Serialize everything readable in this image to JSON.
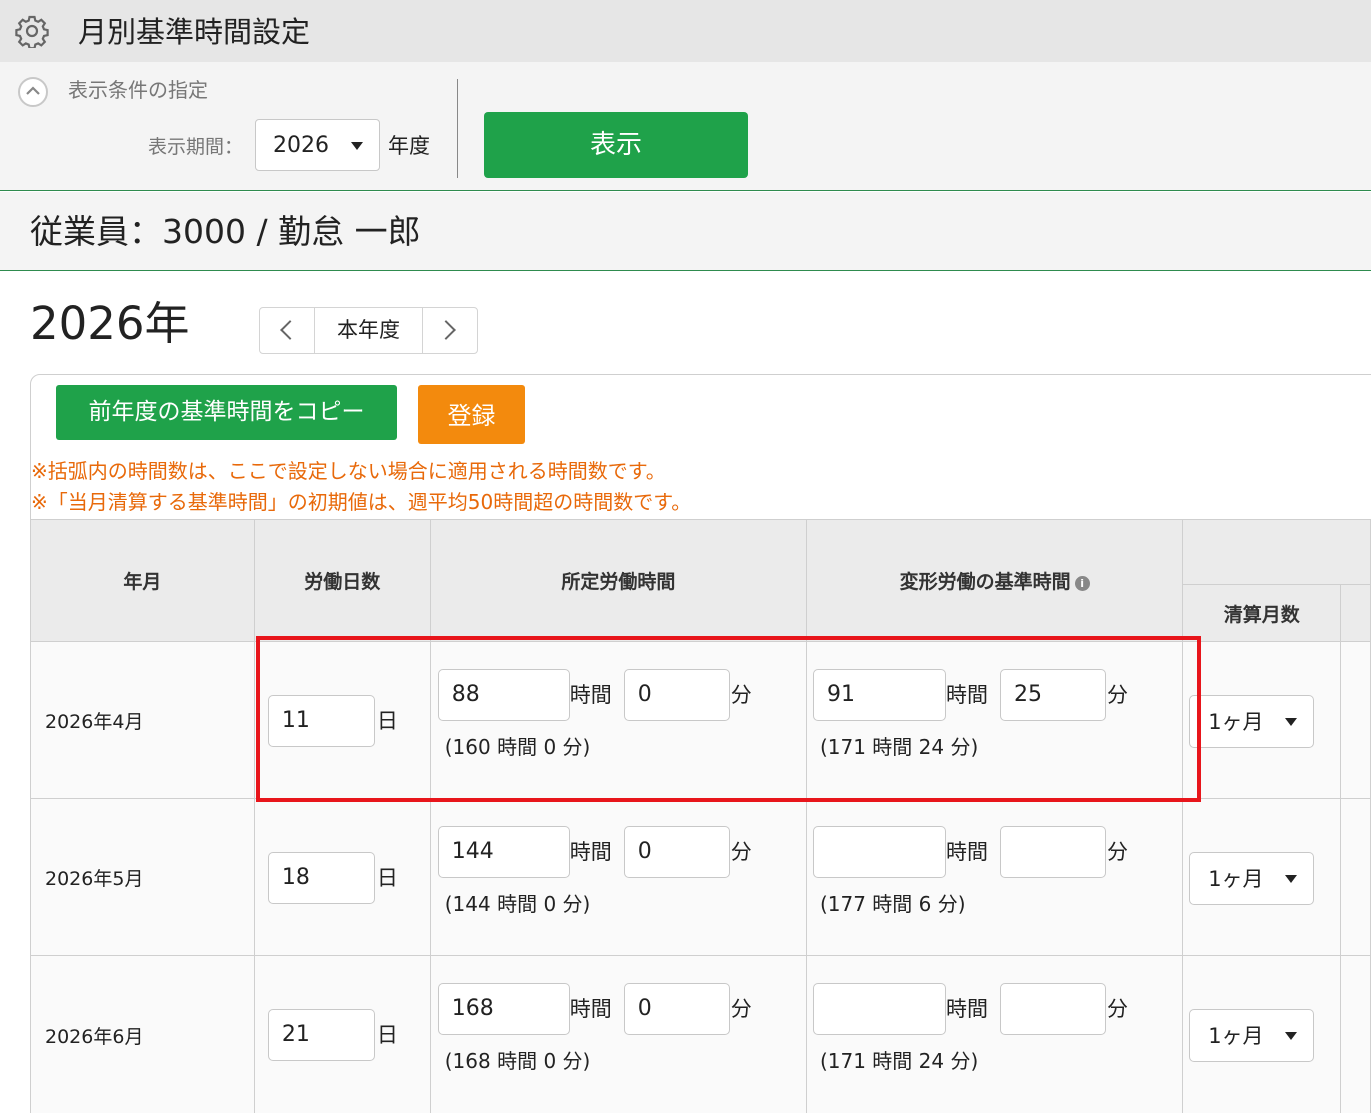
{
  "header": {
    "title": "月別基準時間設定",
    "icon": "gear-icon"
  },
  "conditions": {
    "heading": "表示条件の指定",
    "period_label": "表示期間：",
    "year_value": "2026",
    "year_suffix": "年度",
    "show_button": "表示"
  },
  "employee": {
    "label": "従業員：3000 / 勤怠 一郎"
  },
  "year_nav": {
    "heading": "2026年",
    "current_label": "本年度"
  },
  "actions": {
    "copy_button": "前年度の基準時間をコピー",
    "register_button": "登録"
  },
  "notes": [
    "※括弧内の時間数は、ここで設定しない場合に適用される時間数です。",
    "※「当月清算する基準時間」の初期値は、週平均50時間超の時間数です。"
  ],
  "table": {
    "headers": {
      "year_month": "年月",
      "work_days": "労働日数",
      "scheduled_hours": "所定労働時間",
      "variable_hours": "変形労働の基準時間",
      "settlement_months": "清算月数"
    },
    "units": {
      "day": "日",
      "hour": "時間",
      "minute": "分"
    },
    "rows": [
      {
        "month": "2026年4月",
        "days": "11",
        "sched_h": "88",
        "sched_m": "0",
        "sched_hint": "(160 時間 0 分)",
        "var_h": "91",
        "var_m": "25",
        "var_hint": "(171 時間 24 分)",
        "settle": "1ヶ月"
      },
      {
        "month": "2026年5月",
        "days": "18",
        "sched_h": "144",
        "sched_m": "0",
        "sched_hint": "(144 時間 0 分)",
        "var_h": "",
        "var_m": "",
        "var_hint": "(177 時間 6 分)",
        "settle": "1ヶ月"
      },
      {
        "month": "2026年6月",
        "days": "21",
        "sched_h": "168",
        "sched_m": "0",
        "sched_hint": "(168 時間 0 分)",
        "var_h": "",
        "var_m": "",
        "var_hint": "(171 時間 24 分)",
        "settle": "1ヶ月"
      }
    ]
  },
  "colors": {
    "green": "#1fa24a",
    "orange": "#f38a0d",
    "note": "#e8690a",
    "highlight": "#e8151b"
  }
}
